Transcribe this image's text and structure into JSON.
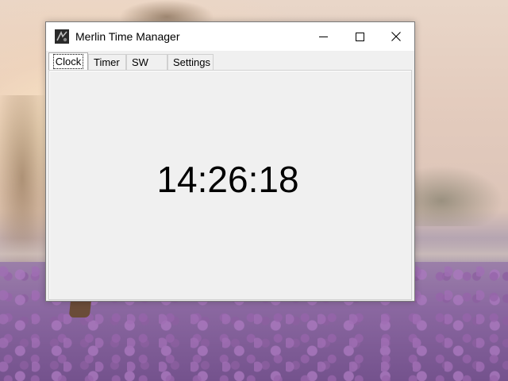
{
  "window": {
    "title": "Merlin Time Manager",
    "icons": {
      "app": "app-icon",
      "minimize": "minimize-icon",
      "maximize": "maximize-icon",
      "close": "close-icon"
    }
  },
  "tabs": [
    {
      "label": "Clock",
      "active": true
    },
    {
      "label": "Timer",
      "active": false
    },
    {
      "label": "SW",
      "active": false
    },
    {
      "label": "Settings",
      "active": false
    }
  ],
  "clock": {
    "time": "14:26:18"
  }
}
